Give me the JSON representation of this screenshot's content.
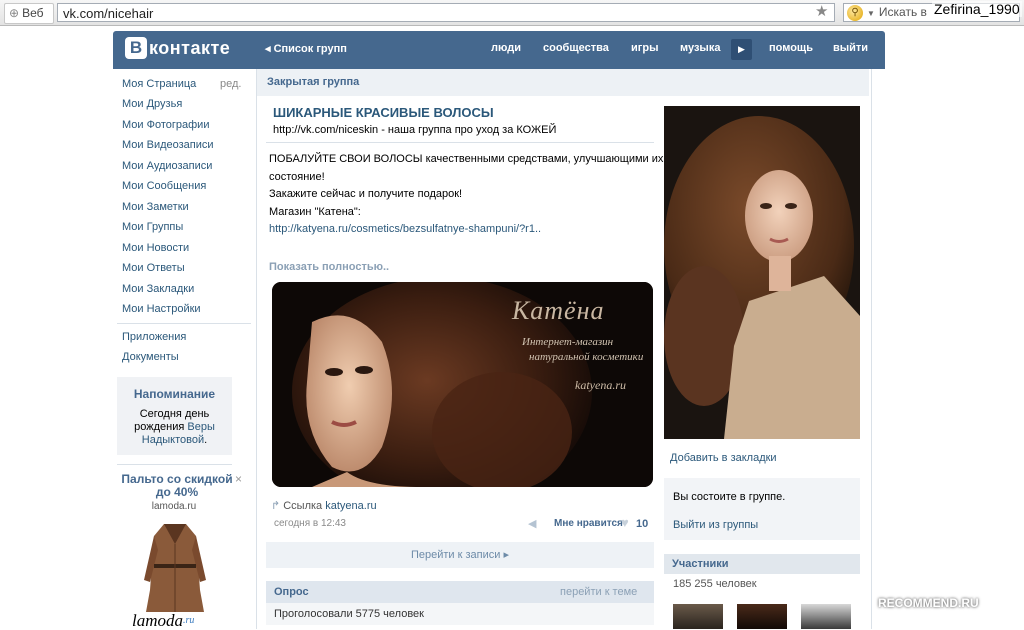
{
  "browser": {
    "tab_label": "Веб",
    "url": "vk.com/nicehair",
    "search_placeholder": "Искать в",
    "user_overlay": "Zefirina_1990"
  },
  "header": {
    "logo_mark": "В",
    "logo_text": "контакте",
    "group_list_link": "Список групп",
    "nav": [
      "люди",
      "сообщества",
      "игры",
      "музыка",
      "помощь",
      "выйти"
    ]
  },
  "left_menu": {
    "items": [
      "Моя Страница",
      "Мои Друзья",
      "Мои Фотографии",
      "Мои Видеозаписи",
      "Мои Аудиозаписи",
      "Мои Сообщения",
      "Мои Заметки",
      "Мои Группы",
      "Мои Новости",
      "Мои Ответы",
      "Мои Закладки",
      "Мои Настройки"
    ],
    "edit_label": "ред.",
    "extra_items": [
      "Приложения",
      "Документы"
    ]
  },
  "reminder": {
    "title": "Напоминание",
    "text_prefix": "Сегодня ",
    "text_day": "день рождения",
    "text_name": "Веры Надыктовой",
    "text_suffix": "."
  },
  "ad": {
    "title": "Пальто со скидкой до 40%",
    "close": "×",
    "domain": "lamoda.ru",
    "brand": "lamoda",
    "brand_suffix": ".ru"
  },
  "group": {
    "closed_label": "Закрытая группа",
    "name": "ШИКАРНЫЕ КРАСИВЫЕ ВОЛОСЫ",
    "description": "http://vk.com/niceskin - наша группа про уход за КОЖЕЙ"
  },
  "post": {
    "lines": [
      "ПОБАЛУЙТЕ СВОИ ВОЛОСЫ качественными средствами, улучшающими их",
      "состояние!",
      "Закажите сейчас и получите подарок!",
      "Магазин \"Катена\":"
    ],
    "link": "http://katyena.ru/cosmetics/bezsulfatnye-shampuni/?r1..",
    "show_full": "Показать полностью..",
    "banner_brand": "Катёна",
    "banner_line1": "Интернет-магазин",
    "banner_line2": "натуральной косметики",
    "banner_site": "katyena.ru",
    "link_label": "Ссылка",
    "link_domain": "katyena.ru",
    "date": "сегодня в 12:43",
    "like_label": "Мне нравится",
    "like_count": "10",
    "goto_post": "Перейти к записи"
  },
  "poll": {
    "title": "Опрос",
    "topic_link": "перейти к теме",
    "votes": "Проголосовали 5775 человек"
  },
  "right": {
    "bookmark": "Добавить в закладки",
    "member_status": "Вы состоите в группе.",
    "leave": "Выйти из группы",
    "participants_title": "Участники",
    "participants_count": "185 255 человек"
  },
  "watermark": "RECOMMEND.RU",
  "icons": {
    "veb": "globe-icon",
    "star": "star-icon",
    "search": "magnifier-icon",
    "link": "link-arrow-icon",
    "share": "megaphone-icon",
    "like": "heart-icon",
    "nav_more": "play-icon"
  },
  "colors": {
    "vk_header": "#45688e",
    "link": "#2b587a",
    "muted_header": "#edf1f5"
  }
}
